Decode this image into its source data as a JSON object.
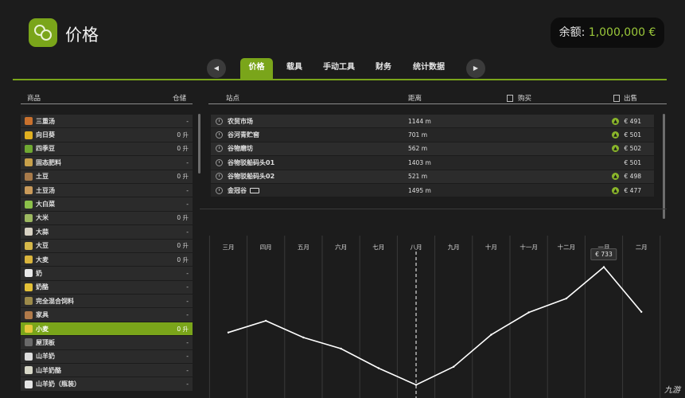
{
  "header": {
    "title": "价格",
    "balance_label": "余额:",
    "balance_value": "1,000,000 €"
  },
  "tabs": [
    {
      "label": "价格",
      "active": true
    },
    {
      "label": "载具",
      "active": false
    },
    {
      "label": "手动工具",
      "active": false
    },
    {
      "label": "财务",
      "active": false
    },
    {
      "label": "统计数据",
      "active": false
    }
  ],
  "columns": {
    "goods": "商品",
    "storage": "仓储",
    "station": "站点",
    "distance": "距离",
    "buy": "购买",
    "sell": "出售"
  },
  "goods": [
    {
      "name": "三重汤",
      "stock": "-",
      "icon": "soup-icon",
      "color": "#c9712d"
    },
    {
      "name": "向日葵",
      "stock": "0 升",
      "icon": "sunflower-icon",
      "color": "#e0b020"
    },
    {
      "name": "四季豆",
      "stock": "0 升",
      "icon": "bean-icon",
      "color": "#6fa832"
    },
    {
      "name": "固态肥料",
      "stock": "-",
      "icon": "fertilizer-icon",
      "color": "#c7a04a"
    },
    {
      "name": "土豆",
      "stock": "0 升",
      "icon": "potato-icon",
      "color": "#a77a4a"
    },
    {
      "name": "土豆汤",
      "stock": "-",
      "icon": "potato-soup-icon",
      "color": "#c99a5a"
    },
    {
      "name": "大白菜",
      "stock": "-",
      "icon": "cabbage-icon",
      "color": "#8cc04a"
    },
    {
      "name": "大米",
      "stock": "0 升",
      "icon": "rice-icon",
      "color": "#9cb860"
    },
    {
      "name": "大蒜",
      "stock": "-",
      "icon": "garlic-icon",
      "color": "#d8d2c4"
    },
    {
      "name": "大豆",
      "stock": "0 升",
      "icon": "soybean-icon",
      "color": "#d6b84a"
    },
    {
      "name": "大麦",
      "stock": "0 升",
      "icon": "barley-icon",
      "color": "#d9b43c"
    },
    {
      "name": "奶",
      "stock": "-",
      "icon": "milk-icon",
      "color": "#e8e8e8"
    },
    {
      "name": "奶酪",
      "stock": "-",
      "icon": "cheese-icon",
      "color": "#e3c036"
    },
    {
      "name": "完全混合饲料",
      "stock": "-",
      "icon": "feed-icon",
      "color": "#9c8a4a"
    },
    {
      "name": "家具",
      "stock": "-",
      "icon": "furniture-icon",
      "color": "#b07a4a"
    },
    {
      "name": "小麦",
      "stock": "0 升",
      "icon": "wheat-icon",
      "color": "#e6c63a",
      "selected": true
    },
    {
      "name": "屋顶板",
      "stock": "-",
      "icon": "roof-panel-icon",
      "color": "#6a6a6a"
    },
    {
      "name": "山羊奶",
      "stock": "-",
      "icon": "goat-milk-icon",
      "color": "#dddddd"
    },
    {
      "name": "山羊奶酪",
      "stock": "-",
      "icon": "goat-cheese-icon",
      "color": "#d8d8c8"
    },
    {
      "name": "山羊奶（瓶装）",
      "stock": "-",
      "icon": "bottled-goat-milk-icon",
      "color": "#e4e4e4"
    }
  ],
  "stations": [
    {
      "name": "农贸市场",
      "distance": "1144 m",
      "price": "€ 491",
      "trend": true,
      "train": false
    },
    {
      "name": "谷河青贮窖",
      "distance": "701 m",
      "price": "€ 501",
      "trend": true,
      "train": false
    },
    {
      "name": "谷物磨坊",
      "distance": "562 m",
      "price": "€ 502",
      "trend": true,
      "train": false
    },
    {
      "name": "谷物驳船码头01",
      "distance": "1403 m",
      "price": "€ 501",
      "trend": false,
      "train": false
    },
    {
      "name": "谷物驳船码头02",
      "distance": "521 m",
      "price": "€ 498",
      "trend": true,
      "train": false
    },
    {
      "name": "金冠谷",
      "distance": "1495 m",
      "price": "€ 477",
      "trend": true,
      "train": true
    }
  ],
  "chart_data": {
    "type": "line",
    "categories": [
      "三月",
      "四月",
      "五月",
      "六月",
      "七月",
      "八月",
      "九月",
      "十月",
      "十一月",
      "十二月",
      "一月",
      "二月"
    ],
    "current_month_index": 5,
    "highlight": {
      "index": 10,
      "label": "€ 733"
    },
    "series": [
      {
        "values": [
          498,
          540,
          480,
          440,
          370,
          310,
          375,
          490,
          570,
          620,
          733,
          572
        ]
      }
    ],
    "ylim": [
      280,
      760
    ],
    "grid": true,
    "line_color": "#ffffff"
  },
  "watermark": "九游"
}
